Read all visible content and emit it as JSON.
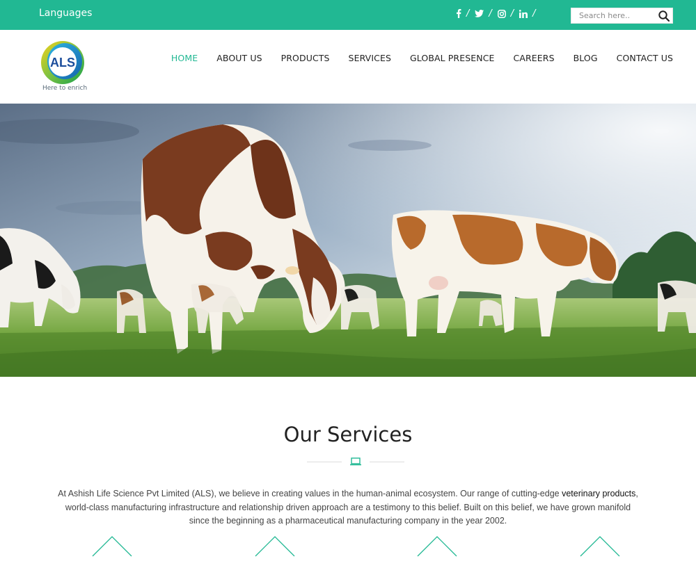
{
  "topbar": {
    "languages_label": "Languages",
    "social_icons": [
      "facebook-icon",
      "twitter-icon",
      "instagram-icon",
      "linkedin-icon"
    ],
    "separator": "/",
    "search_placeholder": "Search here.."
  },
  "brand": {
    "logo_text": "ALS",
    "tagline": "Here to enrich"
  },
  "nav": {
    "items": [
      {
        "label": "HOME",
        "active": true
      },
      {
        "label": "ABOUT US"
      },
      {
        "label": "PRODUCTS"
      },
      {
        "label": "SERVICES"
      },
      {
        "label": "GLOBAL PRESENCE"
      },
      {
        "label": "CAREERS"
      },
      {
        "label": "BLOG"
      },
      {
        "label": "CONTACT US"
      }
    ]
  },
  "services": {
    "title": "Our Services",
    "intro_part1": "At Ashish Life Science Pvt Limited (ALS), we believe in creating values in the human-animal ecosystem. Our range of cutting-edge ",
    "intro_link": "veterinary products",
    "intro_part2": ", world-class manufacturing infrastructure and relationship driven approach are a testimony to this belief. Built on this belief, we have grown manifold since the beginning as a pharmaceutical manufacturing company in the year 2002."
  },
  "colors": {
    "accent": "#21b893",
    "text": "#222222"
  }
}
